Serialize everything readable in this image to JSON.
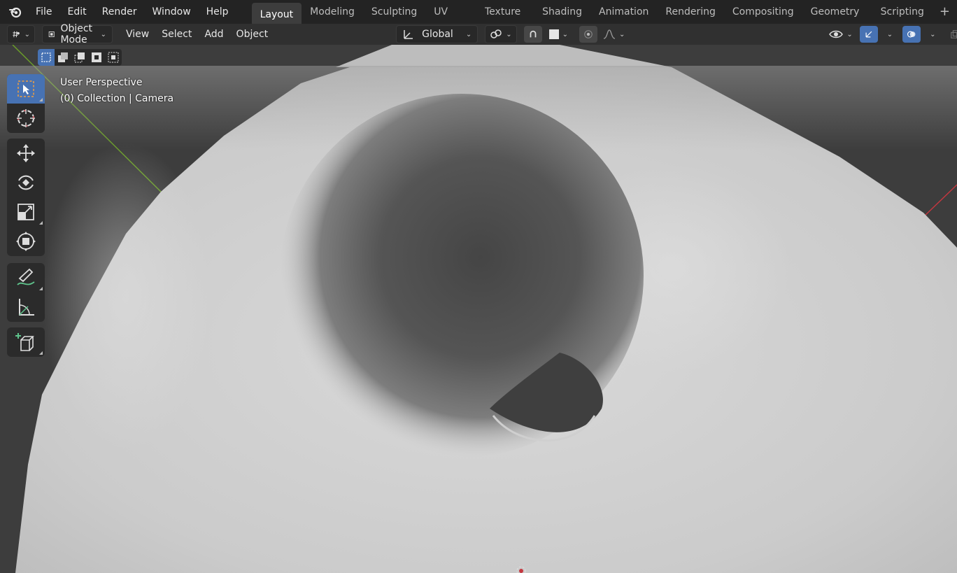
{
  "topbar": {
    "menus": [
      "File",
      "Edit",
      "Render",
      "Window",
      "Help"
    ],
    "tabs": [
      "Layout",
      "Modeling",
      "Sculpting",
      "UV Editing",
      "Texture Paint",
      "Shading",
      "Animation",
      "Rendering",
      "Compositing",
      "Geometry Nodes",
      "Scripting"
    ],
    "active_tab": "Layout",
    "add_tab": "+"
  },
  "header": {
    "mode": "Object Mode",
    "menus": [
      "View",
      "Select",
      "Add",
      "Object"
    ],
    "orientation": "Global"
  },
  "viewport": {
    "perspective": "User Perspective",
    "collection": "(0) Collection | Camera"
  },
  "colors": {
    "accent": "#4772b3",
    "x_axis": "#c4373f",
    "y_axis": "#6a9c2a"
  },
  "icons": {
    "toolbar": [
      "select-box-icon",
      "cursor-icon",
      "move-icon",
      "rotate-icon",
      "scale-icon",
      "transform-icon",
      "annotate-icon",
      "measure-icon",
      "add-cube-icon"
    ]
  }
}
